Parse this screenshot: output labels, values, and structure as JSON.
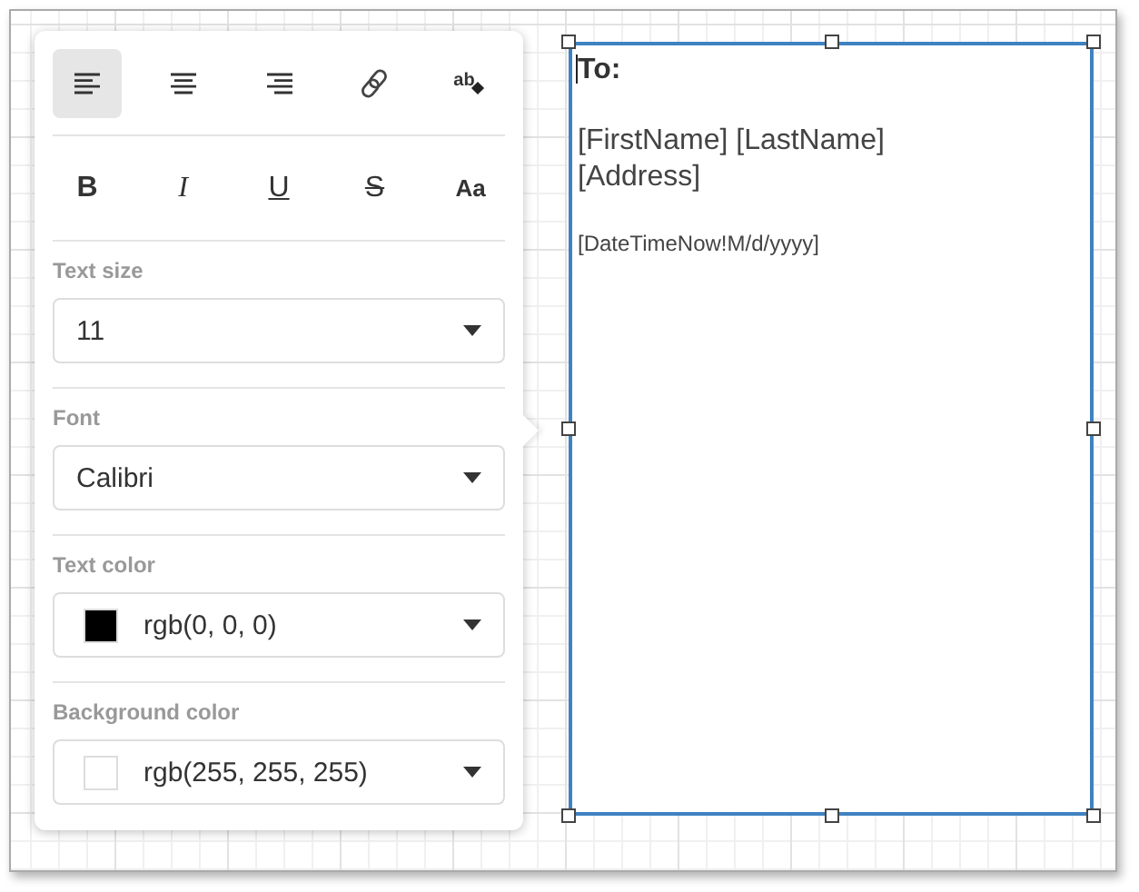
{
  "toolbar": {
    "align_buttons": [
      {
        "kind": "align-left",
        "selected": true
      },
      {
        "kind": "align-center",
        "selected": false
      },
      {
        "kind": "align-right",
        "selected": false
      },
      {
        "kind": "link",
        "selected": false
      },
      {
        "kind": "clear-format",
        "label": "ab",
        "selected": false
      }
    ],
    "format_buttons": [
      {
        "kind": "bold",
        "label": "B"
      },
      {
        "kind": "italic",
        "label": "I"
      },
      {
        "kind": "underline",
        "label": "U"
      },
      {
        "kind": "strike",
        "label": "S"
      },
      {
        "kind": "case",
        "label": "Aa"
      }
    ]
  },
  "fields": [
    {
      "label": "Text size",
      "value": "11"
    },
    {
      "label": "Font",
      "value": "Calibri"
    },
    {
      "label": "Text color",
      "value": "rgb(0, 0, 0)",
      "color": "#000000"
    },
    {
      "label": "Background color",
      "value": "rgb(255, 255, 255)",
      "color": "#ffffff"
    }
  ],
  "document": {
    "paragraphs": [
      {
        "kind": "heading",
        "lines": [
          "To:"
        ]
      },
      {
        "kind": "large",
        "lines": [
          "[FirstName] [LastName]",
          "[Address]"
        ]
      },
      {
        "kind": "small",
        "lines": [
          "[DateTimeNow!M/d/yyyy]"
        ]
      }
    ]
  }
}
